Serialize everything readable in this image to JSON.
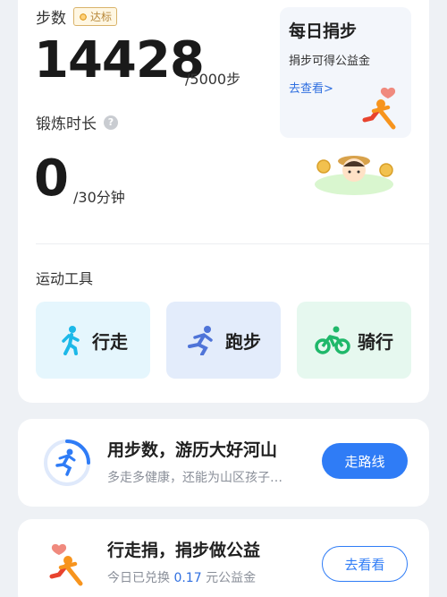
{
  "steps": {
    "label": "步数",
    "badge": "达标",
    "value": "14428",
    "goal": "/5000步"
  },
  "exercise": {
    "label": "锻炼时长",
    "value": "0",
    "goal": "/30分钟"
  },
  "daily_donation": {
    "title": "每日捐步",
    "subtitle": "捐步可得公益金",
    "link": "去查看>"
  },
  "tools": {
    "title": "运动工具",
    "items": [
      {
        "label": "行走",
        "icon": "walking-person-icon",
        "color": "#1cb8e8"
      },
      {
        "label": "跑步",
        "icon": "running-person-icon",
        "color": "#4f74d8"
      },
      {
        "label": "骑行",
        "icon": "cycling-person-icon",
        "color": "#1fb86a"
      }
    ]
  },
  "route_card": {
    "title": "用步数，游历大好河山",
    "subtitle": "多走多健康，还能为山区孩子…",
    "button": "走路线"
  },
  "charity_card": {
    "title": "行走捐，捐步做公益",
    "subtitle_prefix": "今日已兑换",
    "subtitle_amount": "0.17",
    "subtitle_suffix": "元公益金",
    "button": "去看看"
  },
  "colors": {
    "accent": "#2f7cf6",
    "link": "#2f6fe0",
    "runner_orange": "#f7941d",
    "runner_red": "#e8432e"
  }
}
